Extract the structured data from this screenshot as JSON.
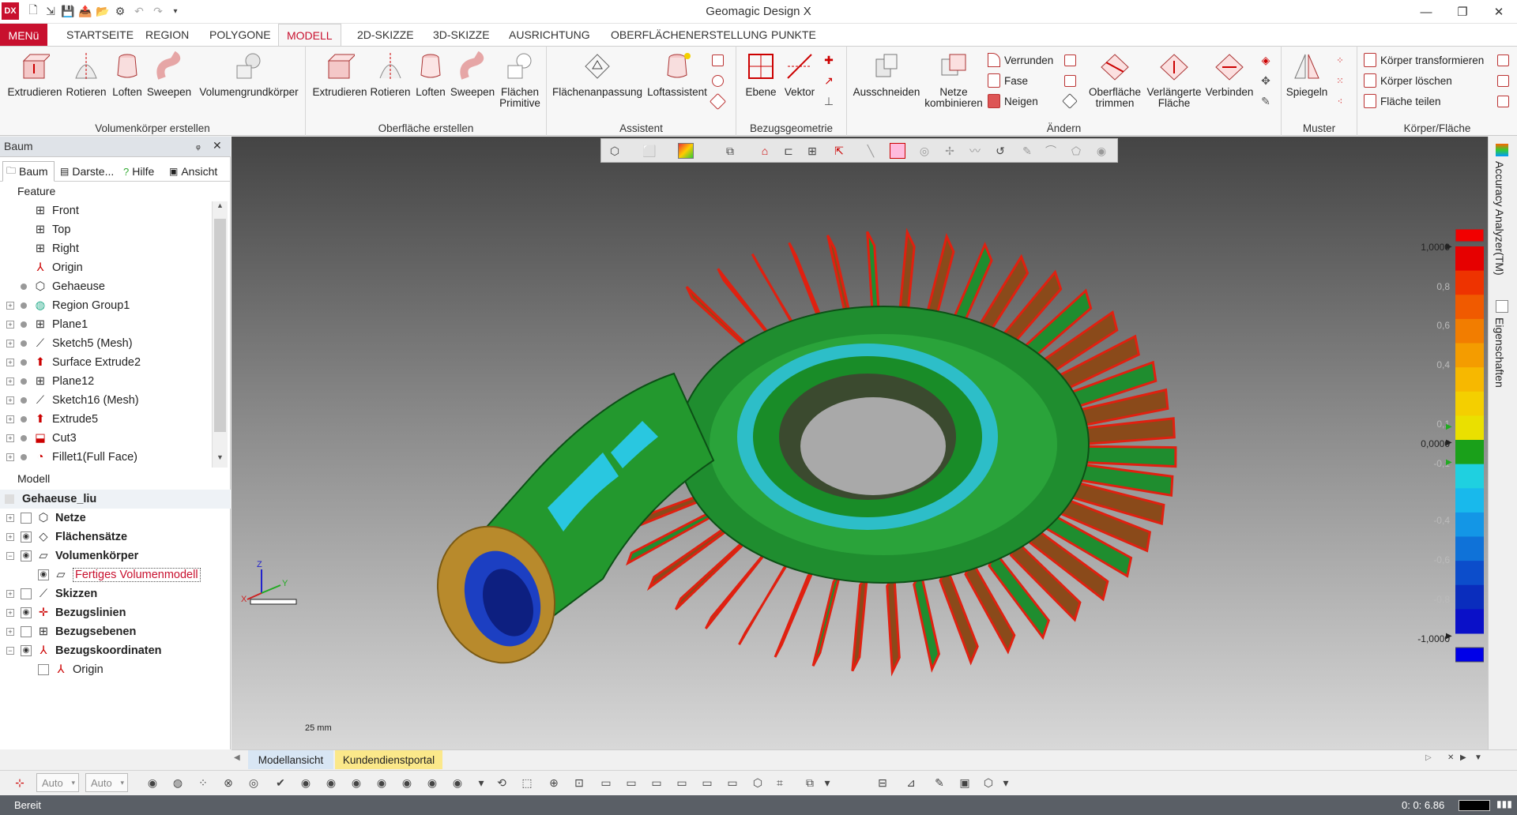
{
  "app": {
    "logo": "DX",
    "title": "Geomagic Design X",
    "window_buttons": [
      "—",
      "❐",
      "✕"
    ]
  },
  "tabs": {
    "menu": "MENü",
    "items": [
      "STARTSEITE",
      "REGION",
      "POLYGONE",
      "MODELL",
      "2D-SKIZZE",
      "3D-SKIZZE",
      "AUSRICHTUNG",
      "OBERFLÄCHENERSTELLUNG",
      "PUNKTE"
    ],
    "active": "MODELL"
  },
  "ribbon": {
    "groups": {
      "volume": {
        "label": "Volumenkörper erstellen",
        "buttons": [
          "Extrudieren",
          "Rotieren",
          "Loften",
          "Sweepen",
          "Volumengrundkörper"
        ]
      },
      "surface": {
        "label": "Oberfläche erstellen",
        "buttons": [
          "Extrudieren",
          "Rotieren",
          "Loften",
          "Sweepen"
        ],
        "primitive_line1": "Flächen",
        "primitive_line2": "Primitive"
      },
      "assistant": {
        "label": "Assistent",
        "buttons": [
          "Flächenanpassung",
          "Loftassistent"
        ]
      },
      "reference": {
        "label": "Bezugsgeometrie",
        "buttons": [
          "Ebene",
          "Vektor"
        ]
      },
      "modify": {
        "label": "Ändern",
        "ausschneiden": "Ausschneiden",
        "netze_line1": "Netze",
        "netze_line2": "kombinieren",
        "small": [
          "Verrunden",
          "Fase",
          "Neigen"
        ],
        "trim_line1": "Oberfläche",
        "trim_line2": "trimmen",
        "extend_line1": "Verlängerte",
        "extend_line2": "Fläche",
        "verbinden": "Verbinden"
      },
      "pattern": {
        "label": "Muster",
        "spiegeln": "Spiegeln"
      },
      "body": {
        "label": "Körper/Fläche",
        "small": [
          "Körper transformieren",
          "Körper löschen",
          "Fläche teilen"
        ]
      }
    }
  },
  "panel": {
    "title": "Baum",
    "pin": "ᵩ",
    "close": "✕",
    "tabs": [
      "Baum",
      "Darste...",
      "Hilfe",
      "Ansicht"
    ],
    "feature_header": "Feature",
    "features": [
      {
        "label": "Front",
        "icon": "plane-icon",
        "expand": false,
        "dot": false
      },
      {
        "label": "Top",
        "icon": "plane-icon",
        "expand": false,
        "dot": false
      },
      {
        "label": "Right",
        "icon": "plane-icon",
        "expand": false,
        "dot": false
      },
      {
        "label": "Origin",
        "icon": "axis-icon",
        "expand": false,
        "dot": false
      },
      {
        "label": "Gehaeuse",
        "icon": "mesh-icon",
        "expand": false,
        "dot": true
      },
      {
        "label": "Region Group1",
        "icon": "region-icon",
        "expand": true,
        "dot": true
      },
      {
        "label": "Plane1",
        "icon": "plane-icon",
        "expand": true,
        "dot": true
      },
      {
        "label": "Sketch5 (Mesh)",
        "icon": "sketch-icon",
        "expand": true,
        "dot": true
      },
      {
        "label": "Surface Extrude2",
        "icon": "extrude-icon",
        "expand": true,
        "dot": true
      },
      {
        "label": "Plane12",
        "icon": "plane-icon",
        "expand": true,
        "dot": true
      },
      {
        "label": "Sketch16 (Mesh)",
        "icon": "sketch-icon",
        "expand": true,
        "dot": true
      },
      {
        "label": "Extrude5",
        "icon": "extrude-icon",
        "expand": true,
        "dot": true
      },
      {
        "label": "Cut3",
        "icon": "cut-icon",
        "expand": true,
        "dot": true
      },
      {
        "label": "Fillet1(Full Face)",
        "icon": "fillet-icon",
        "expand": true,
        "dot": true
      }
    ],
    "model_header": "Modell",
    "model_root": "Gehaeuse_liu",
    "model_items": [
      {
        "label": "Netze",
        "indent": 0,
        "expand": "+",
        "vis": "box",
        "icon": "mesh-icon",
        "bold": true
      },
      {
        "label": "Flächensätze",
        "indent": 0,
        "expand": "+",
        "vis": "eye",
        "icon": "faceset-icon",
        "bold": true
      },
      {
        "label": "Volumenkörper",
        "indent": 0,
        "expand": "−",
        "vis": "eye",
        "icon": "solid-icon",
        "bold": true
      },
      {
        "label": "Fertiges Volumenmodell",
        "indent": 1,
        "expand": "",
        "vis": "eye",
        "icon": "solid-icon",
        "bold": false,
        "selected": true
      },
      {
        "label": "Skizzen",
        "indent": 0,
        "expand": "+",
        "vis": "box",
        "icon": "sketch-icon",
        "bold": true
      },
      {
        "label": "Bezugslinien",
        "indent": 0,
        "expand": "+",
        "vis": "eye",
        "icon": "refline-icon",
        "bold": true
      },
      {
        "label": "Bezugsebenen",
        "indent": 0,
        "expand": "+",
        "vis": "box",
        "icon": "plane-icon",
        "bold": true
      },
      {
        "label": "Bezugskoordinaten",
        "indent": 0,
        "expand": "−",
        "vis": "eye",
        "icon": "axis-icon",
        "bold": true
      },
      {
        "label": "Origin",
        "indent": 1,
        "expand": "",
        "vis": "box",
        "icon": "axis-icon",
        "bold": false
      }
    ]
  },
  "viewport": {
    "scale_label": "25 mm",
    "axis_labels": {
      "x": "X",
      "y": "Y",
      "z": "Z"
    },
    "legend": {
      "labels": [
        {
          "text": "1,0000",
          "faint": false
        },
        {
          "text": "0,8",
          "faint": true
        },
        {
          "text": "0,6",
          "faint": true
        },
        {
          "text": "0,4",
          "faint": true
        },
        {
          "text": "0,1",
          "faint": true
        },
        {
          "text": "0,0000",
          "faint": false
        },
        {
          "text": "-0,1",
          "faint": true
        },
        {
          "text": "-0,4",
          "faint": true
        },
        {
          "text": "-0,6",
          "faint": true
        },
        {
          "text": "-0,8",
          "faint": true
        },
        {
          "text": "-1,0000",
          "faint": false
        }
      ],
      "colors": [
        "#e60000",
        "#ee3300",
        "#f05a00",
        "#f27d00",
        "#f49c00",
        "#f7b800",
        "#f4cf00",
        "#eae000",
        "#1aa01a",
        "#1fd0e0",
        "#18b9ec",
        "#1396e6",
        "#0f72d8",
        "#0c4dcb",
        "#0a2dbd",
        "#0a10c8"
      ],
      "over_color": "#f20000",
      "under_color": "#0000e8"
    }
  },
  "side_tabs": [
    "Accuracy Analyzer(TM)",
    "Eigenschaften"
  ],
  "view_tabs": [
    "Modellansicht",
    "Kundendienstportal"
  ],
  "bottom": {
    "combo1": "Auto",
    "combo2": "Auto"
  },
  "status": {
    "text": "Bereit",
    "time": "0: 0: 6.86"
  }
}
